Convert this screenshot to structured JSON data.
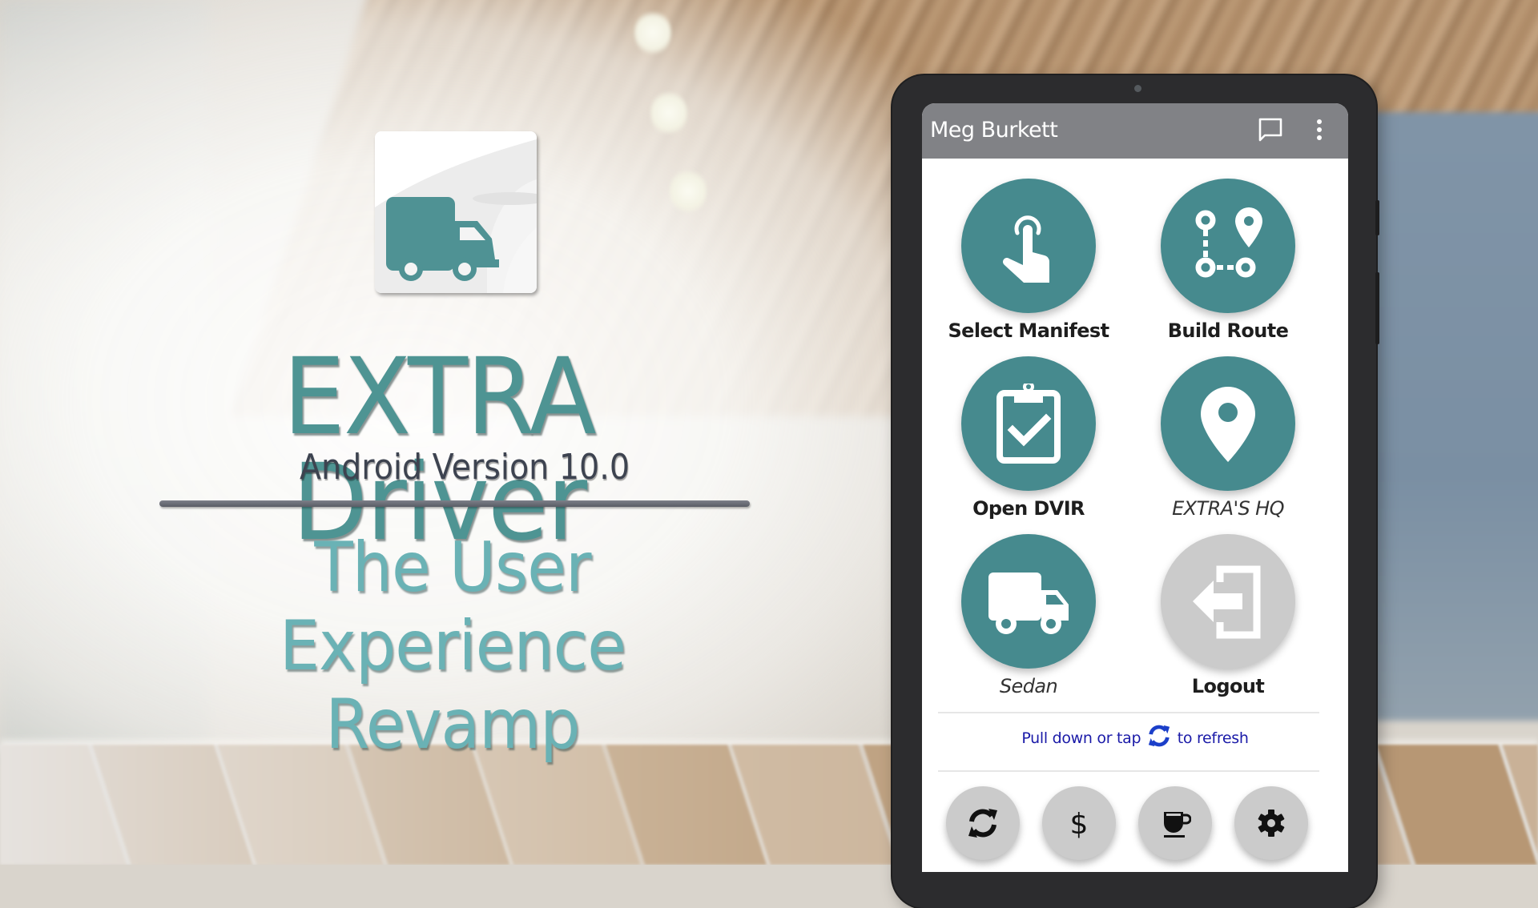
{
  "promo": {
    "title": "EXTRA Driver",
    "version": "Android Version 10.0",
    "subtitle_line1": "The User",
    "subtitle_line2": "Experience Revamp",
    "logo_icon": "delivery-truck-icon"
  },
  "colors": {
    "brand_teal": "#468a8e",
    "title_teal": "#4e9493",
    "subtitle_teal": "#6ab2b5",
    "appbar_gray": "#818286",
    "disabled_gray": "#cbcbcb",
    "hint_blue": "#1a1aa8"
  },
  "app": {
    "appbar": {
      "title": "Meg Burkett",
      "actions": [
        {
          "icon": "chat-bubble-icon",
          "label": "Messages"
        },
        {
          "icon": "more-vert-icon",
          "label": "More options"
        }
      ]
    },
    "tiles": [
      {
        "label": "Select Manifest",
        "icon": "touch-tap-icon",
        "style": "bold",
        "state": "active"
      },
      {
        "label": "Build Route",
        "icon": "route-icon",
        "style": "bold",
        "state": "active"
      },
      {
        "label": "Open DVIR",
        "icon": "clipboard-check-icon",
        "style": "bold",
        "state": "active"
      },
      {
        "label": "EXTRA'S HQ",
        "icon": "map-pin-icon",
        "style": "italic",
        "state": "active"
      },
      {
        "label": "Sedan",
        "icon": "truck-icon",
        "style": "italic",
        "state": "active"
      },
      {
        "label": "Logout",
        "icon": "logout-icon",
        "style": "bold",
        "state": "disabled"
      }
    ],
    "refresh_hint": {
      "before": "Pull down or tap",
      "after": "to refresh",
      "icon": "refresh-icon"
    },
    "bottom_actions": [
      {
        "icon": "refresh-icon",
        "label": "Refresh"
      },
      {
        "icon": "dollar-icon",
        "label": "Expenses"
      },
      {
        "icon": "coffee-cup-icon",
        "label": "Break"
      },
      {
        "icon": "gear-icon",
        "label": "Settings"
      }
    ]
  }
}
